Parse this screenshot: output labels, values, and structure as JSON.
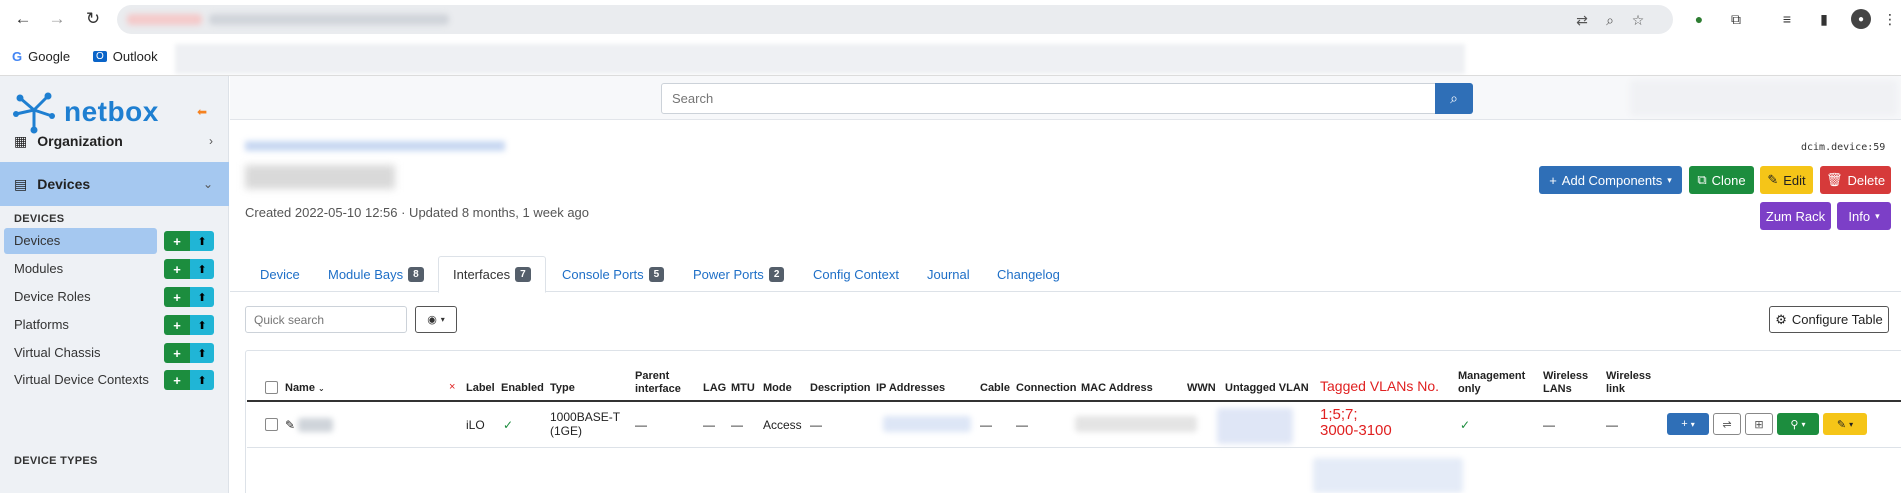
{
  "browser": {
    "bookmarks": [
      {
        "label": "Google",
        "icon": "google-icon"
      },
      {
        "label": "Outlook",
        "icon": "outlook-icon"
      }
    ]
  },
  "sidebar": {
    "brand": "netbox",
    "menus": [
      {
        "label": "Organization",
        "icon": "building-icon"
      },
      {
        "label": "Devices",
        "icon": "server-icon",
        "active": true
      }
    ],
    "section_devices": "DEVICES",
    "items": [
      {
        "label": "Devices",
        "selected": true
      },
      {
        "label": "Modules"
      },
      {
        "label": "Device Roles"
      },
      {
        "label": "Platforms"
      },
      {
        "label": "Virtual Chassis"
      },
      {
        "label": "Virtual Device Contexts"
      }
    ],
    "section_device_types": "DEVICE TYPES"
  },
  "topbar": {
    "search_placeholder": "Search"
  },
  "header": {
    "object_id": "dcim.device:59",
    "created": "Created 2022-05-10 12:56 · Updated 8 months, 1 week ago",
    "buttons": {
      "add_components": "Add Components",
      "clone": "Clone",
      "edit": "Edit",
      "delete": "Delete",
      "zum_rack": "Zum Rack",
      "info": "Info"
    }
  },
  "tabs": [
    {
      "label": "Device"
    },
    {
      "label": "Module Bays",
      "badge": "8"
    },
    {
      "label": "Interfaces",
      "badge": "7",
      "active": true
    },
    {
      "label": "Console Ports",
      "badge": "5"
    },
    {
      "label": "Power Ports",
      "badge": "2"
    },
    {
      "label": "Config Context"
    },
    {
      "label": "Journal"
    },
    {
      "label": "Changelog"
    }
  ],
  "toolbar": {
    "quick_search_placeholder": "Quick search",
    "configure_table": "Configure Table"
  },
  "table": {
    "columns": {
      "name": "Name",
      "label": "Label",
      "enabled": "Enabled",
      "type": "Type",
      "parent_1": "Parent",
      "parent_2": "interface",
      "lag": "LAG",
      "mtu": "MTU",
      "mode": "Mode",
      "description": "Description",
      "ip_addresses": "IP Addresses",
      "cable": "Cable",
      "connection": "Connection",
      "mac": "MAC Address",
      "wwn": "WWN",
      "untagged_vlan": "Untagged VLAN",
      "tagged_vlans": "Tagged VLANs No.",
      "mgmt_1": "Management",
      "mgmt_2": "only",
      "wlan_1": "Wireless",
      "wlan_2": "LANs",
      "wlink_1": "Wireless",
      "wlink_2": "link"
    },
    "row": {
      "label": "iLO",
      "enabled": "✓",
      "type_1": "1000BASE-T",
      "type_2": "(1GE)",
      "parent": "—",
      "lag": "—",
      "mtu": "—",
      "mode": "Access",
      "description": "—",
      "cable": "—",
      "connection": "—",
      "tagged_1": "1;5;7;",
      "tagged_2": "3000-3100",
      "mgmt_only": "✓",
      "wlan": "—",
      "wlink": "—"
    }
  },
  "colors": {
    "primary": "#2f6fb7",
    "success": "#1c8d3e",
    "warning": "#f5c518",
    "danger": "#d63a3a",
    "purple": "#7c3fc7",
    "annotation": "#e02020"
  }
}
